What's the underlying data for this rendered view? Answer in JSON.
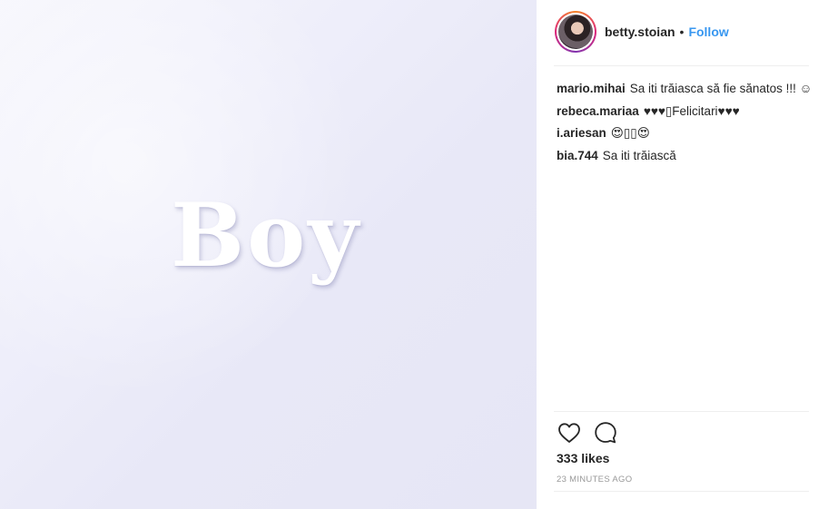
{
  "post": {
    "image_text": "Boy",
    "username": "betty.stoian",
    "separator": "•",
    "follow_label": "Follow",
    "likes": "333 likes",
    "timestamp": "23 MINUTES AGO"
  },
  "comments": [
    {
      "author": "mario.mihai",
      "text": "Sa iti trăiasca să fie sănatos !!! ☺"
    },
    {
      "author": "rebeca.mariaa",
      "text": "♥♥♥▯Felicitari♥♥♥"
    },
    {
      "author": "i.ariesan",
      "text": "😍▯▯😍"
    },
    {
      "author": "bia.744",
      "text": "Sa iti trăiască"
    }
  ],
  "icons": {
    "like": "heart-icon",
    "comment": "comment-bubble-icon"
  },
  "colors": {
    "follow": "#3897f0",
    "text": "#262626",
    "muted": "#999999",
    "photo_bg": "#ececf8"
  }
}
